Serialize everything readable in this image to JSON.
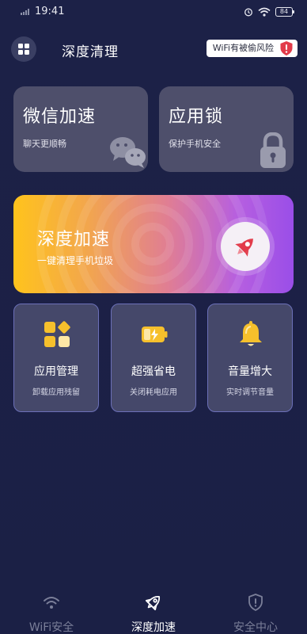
{
  "status": {
    "time": "19:41",
    "battery": "84"
  },
  "header": {
    "title": "深度清理",
    "wifi_risk": "WiFi有被偷风险"
  },
  "cards": [
    {
      "title": "微信加速",
      "subtitle": "聊天更顺畅",
      "icon": "wechat-icon"
    },
    {
      "title": "应用锁",
      "subtitle": "保护手机安全",
      "icon": "padlock-icon"
    }
  ],
  "banner": {
    "title": "深度加速",
    "subtitle": "一键清理手机垃圾",
    "icon": "rocket-icon"
  },
  "tools": [
    {
      "title": "应用管理",
      "subtitle": "卸载应用残留",
      "icon": "app-grid-icon"
    },
    {
      "title": "超强省电",
      "subtitle": "关闭耗电应用",
      "icon": "battery-charging-icon"
    },
    {
      "title": "音量增大",
      "subtitle": "实时调节音量",
      "icon": "bell-icon"
    }
  ],
  "nav": [
    {
      "label": "WiFi安全",
      "icon": "wifi-icon",
      "active": false
    },
    {
      "label": "深度加速",
      "icon": "rocket-icon",
      "active": true
    },
    {
      "label": "安全中心",
      "icon": "shield-icon",
      "active": false
    }
  ],
  "colors": {
    "background": "#1c2147",
    "card": "#4e4f6b",
    "tool_card": "#45486a",
    "tool_border": "#6c70b8",
    "banner_start": "#ffc31c",
    "banner_end": "#9a4ee8",
    "accent_red": "#e23b4a",
    "accent_yellow": "#f6c02c"
  }
}
